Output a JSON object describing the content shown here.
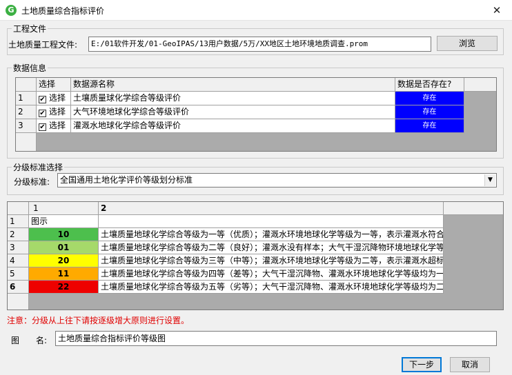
{
  "window": {
    "title": "土地质量综合指标评价",
    "app_icon_letter": "G",
    "close_glyph": "✕"
  },
  "project": {
    "legend": "工程文件",
    "label": "土地质量工程文件:",
    "path": "E:/01软件开发/01-GeoIPAS/13用户数据/5万/XX地区土地环境地质调查.prom",
    "browse_label": "浏览"
  },
  "data_info": {
    "legend": "数据信息",
    "headers": [
      "选择",
      "数据源名称",
      "数据是否存在?"
    ],
    "rows": [
      {
        "num": "1",
        "select": "选择",
        "name": "土壤质量球化学综合等级评价",
        "exists": "存在"
      },
      {
        "num": "2",
        "select": "选择",
        "name": "大气环境地球化学综合等级评价",
        "exists": "存在"
      },
      {
        "num": "3",
        "select": "选择",
        "name": "灌溉水地球化学综合等级评价",
        "exists": "存在"
      }
    ],
    "check_glyph": "✔"
  },
  "grading": {
    "legend": "分级标准选择",
    "label": "分级标准:",
    "selected": "全国通用土地化学评价等级划分标准",
    "arrow": "▼"
  },
  "levels_table": {
    "col_headers": [
      "1",
      "2"
    ],
    "rows": [
      {
        "num": "1",
        "c1": "图示",
        "c2": "",
        "color": ""
      },
      {
        "num": "2",
        "c1": "10",
        "c2": "土壤质量地球化学综合等级为一等（优质）；灌溉水环境地球化学等级为一等，表示灌溉水符合",
        "color": "#4dbf4d"
      },
      {
        "num": "3",
        "c1": "01",
        "c2": "土壤质量地球化学综合等级为二等（良好）；灌溉水没有样本；大气干湿沉降物环境地球化学等",
        "color": "#a6d96a"
      },
      {
        "num": "4",
        "c1": "20",
        "c2": "土壤质量地球化学综合等级为三等（中等）；灌溉水环境地球化学等级为二等，表示灌溉水超标",
        "color": "#ffff00"
      },
      {
        "num": "5",
        "c1": "11",
        "c2": "土壤质量地球化学综合等级为四等（差等）；大气干湿沉降物、灌溉水环境地球化学等级均为一",
        "color": "#ffaa00"
      },
      {
        "num": "6",
        "c1": "22",
        "c2": "土壤质量地球化学综合等级为五等（劣等）；大气干湿沉降物、灌溉水环境地球化学等级均为二",
        "color": "#ee0000"
      }
    ]
  },
  "note": "注意：分级从上往下请按逐级增大原则进行设置。",
  "map_name": {
    "label1": "图",
    "label2": "名:",
    "value": "土地质量综合指标评价等级图"
  },
  "buttons": {
    "next": "下一步",
    "cancel": "取消"
  }
}
